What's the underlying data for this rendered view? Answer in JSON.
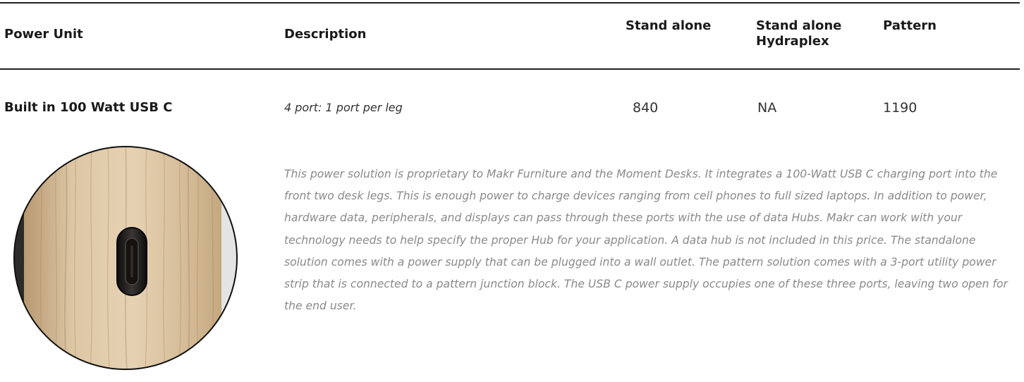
{
  "table": {
    "headers": {
      "power_unit": "Power Unit",
      "description": "Description",
      "stand_alone": "Stand alone",
      "stand_alone_hydraplex_line1": "Stand alone",
      "stand_alone_hydraplex_line2": "Hydraplex",
      "pattern": "Pattern"
    },
    "rows": [
      {
        "power_unit": "Built in 100 Watt USB C",
        "description": "4 port: 1 port per leg",
        "stand_alone": "840",
        "stand_alone_hydraplex": "NA",
        "pattern": "1190"
      }
    ]
  },
  "details": {
    "text": "This power solution is proprietary to Makr Furniture and the Moment Desks. It integrates a 100-Watt USB C charging port into the front two desk legs. This is enough power to charge devices ranging from cell phones to full sized laptops. In addition to power, hardware data, peripherals, and displays can pass through these ports with the use of data Hubs. Makr can work with your technology needs to help specify the proper Hub for your application. A data hub is not included in this price. The standalone solution comes with a power supply that can be plugged into a wall outlet. The pattern solution comes with a 3-port utility power strip that is connected to a pattern junction block. The USB C power supply occupies one of these three ports, leaving two open for the end user."
  },
  "photo": {
    "subject": "usb-c-port-in-wood-desk-leg",
    "colors": {
      "wood_light": "#ddc7a5",
      "wood_dark": "#b89a72",
      "port_outer": "#1c1a19",
      "background_gray": "#d9d9d9"
    }
  }
}
